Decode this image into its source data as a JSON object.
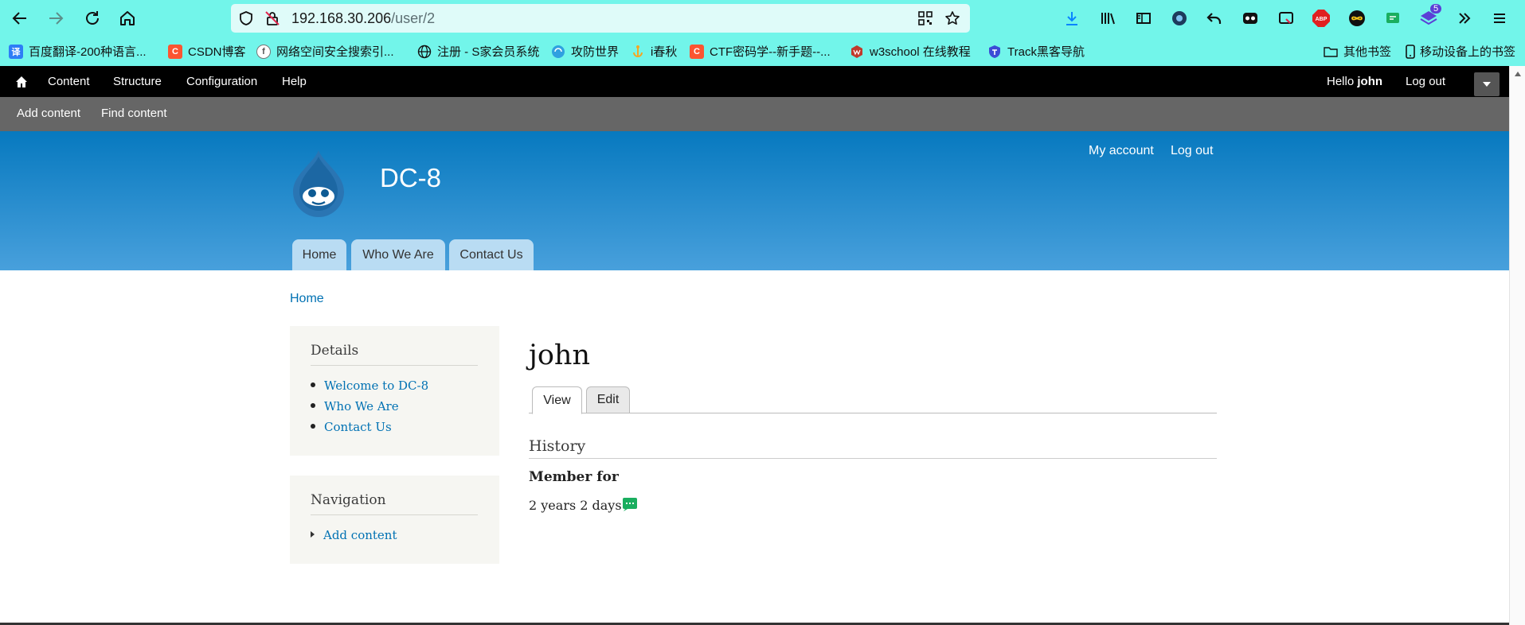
{
  "browser": {
    "url_host": "192.168.30.206",
    "url_path": "/user/2",
    "extension_badge": "5",
    "abp_label": "ABP"
  },
  "bookmarks": {
    "items": [
      {
        "label": "百度翻译-200种语言...",
        "color": "#2d7df6",
        "glyph": "译"
      },
      {
        "label": "CSDN博客",
        "color": "#fc5531",
        "glyph": "C"
      },
      {
        "label": "网络空间安全搜索引...",
        "color": "#ffffff",
        "glyph": "f"
      },
      {
        "label": "注册 - S家会员系统",
        "color": "#ffffff",
        "glyph": ""
      },
      {
        "label": "攻防世界",
        "color": "#2fa0e0",
        "glyph": ""
      },
      {
        "label": "i春秋",
        "color": "#f5a623",
        "glyph": ""
      },
      {
        "label": "CTF密码学--新手题--...",
        "color": "#fc5531",
        "glyph": "C"
      },
      {
        "label": "w3school 在线教程",
        "color": "#c0392b",
        "glyph": ""
      },
      {
        "label": "Track黑客导航",
        "color": "#3b4bd6",
        "glyph": ""
      }
    ],
    "other": "其他书签",
    "mobile": "移动设备上的书签"
  },
  "admin_toolbar": {
    "items": [
      "Content",
      "Structure",
      "Configuration",
      "Help"
    ],
    "hello": "Hello ",
    "user": "john",
    "logout": "Log out",
    "shortcuts": [
      "Add content",
      "Find content"
    ]
  },
  "header": {
    "site_name": "DC-8",
    "secondary": [
      "My account",
      "Log out"
    ],
    "main_menu": [
      "Home",
      "Who We Are",
      "Contact Us"
    ]
  },
  "breadcrumb": "Home",
  "sidebar": {
    "details": {
      "title": "Details",
      "links": [
        "Welcome to DC-8",
        "Who We Are",
        "Contact Us"
      ]
    },
    "navigation": {
      "title": "Navigation",
      "links": [
        "Add content"
      ]
    }
  },
  "main": {
    "title": "john",
    "tabs": [
      "View",
      "Edit"
    ],
    "history_title": "History",
    "member_for_label": "Member for",
    "member_for_value": "2 years 2 days"
  },
  "colors": {
    "chrome": "#72f5ea",
    "link": "#0071b3",
    "header_top": "#0779bf",
    "header_bottom": "#48a0dc"
  }
}
